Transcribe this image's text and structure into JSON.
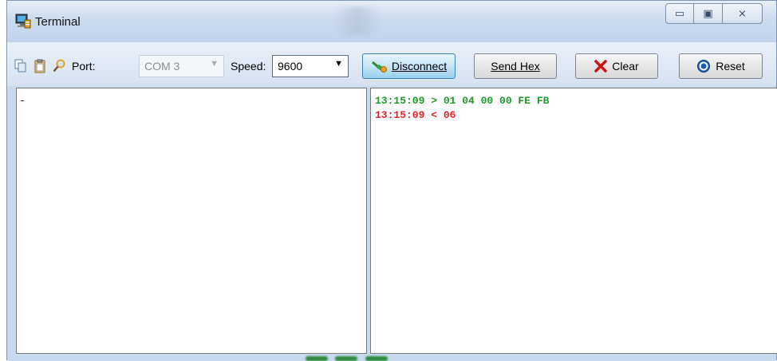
{
  "window": {
    "title": "Terminal",
    "controls": {
      "minimize": "▭",
      "maximize": "▣",
      "close": "⨯"
    }
  },
  "toolbar": {
    "icons": [
      "copy-icon",
      "paste-icon",
      "search-icon"
    ],
    "port_label": "Port:",
    "port_value": "COM 3",
    "speed_label": "Speed:",
    "speed_value": "9600",
    "disconnect_label": "Disconnect",
    "send_hex_label": "Send Hex",
    "clear_label": "Clear",
    "reset_label": "Reset"
  },
  "input_pane": {
    "text": "-"
  },
  "output_pane": {
    "lines": [
      {
        "text": "13:15:09 > 01 04 00 00 FE FB",
        "color": "#1f9a2a"
      },
      {
        "text": "13:15:09 < 06",
        "color": "#e8202a"
      }
    ]
  },
  "colors": {
    "sent": "#1f9a2a",
    "received": "#e8202a",
    "clear_icon": "#c81414",
    "reset_icon": "#1e5fb4"
  }
}
